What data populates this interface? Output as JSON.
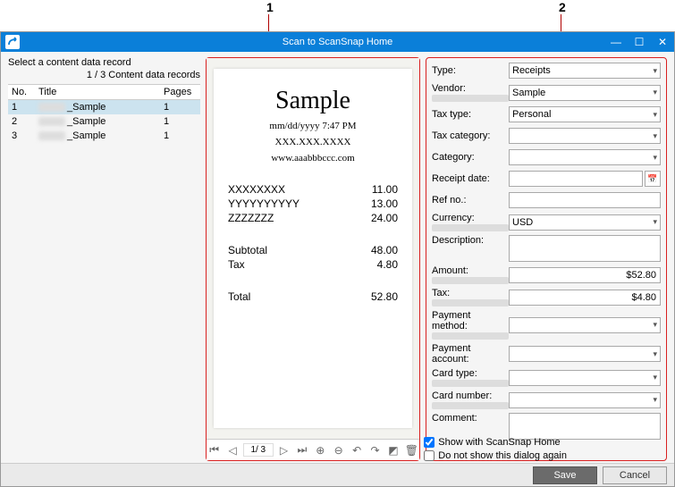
{
  "callouts": {
    "c1": "1",
    "c2": "2"
  },
  "titlebar": {
    "title": "Scan to ScanSnap Home"
  },
  "left": {
    "header": "Select a content data record",
    "count": "1 / 3 Content data records",
    "columns": {
      "no": "No.",
      "title": "Title",
      "pages": "Pages"
    },
    "rows": [
      {
        "no": "1",
        "title": "_Sample",
        "pages": "1"
      },
      {
        "no": "2",
        "title": "_Sample",
        "pages": "1"
      },
      {
        "no": "3",
        "title": "_Sample",
        "pages": "1"
      }
    ]
  },
  "receipt": {
    "title": "Sample",
    "datetime": "mm/dd/yyyy 7:47 PM",
    "phone": "XXX.XXX.XXXX",
    "website": "www.aaabbbccc.com",
    "items": [
      {
        "name": "XXXXXXXX",
        "amount": "11.00"
      },
      {
        "name": "YYYYYYYYYY",
        "amount": "13.00"
      },
      {
        "name": "ZZZZZZZ",
        "amount": "24.00"
      }
    ],
    "subtotal_label": "Subtotal",
    "subtotal": "48.00",
    "tax_label": "Tax",
    "tax": "4.80",
    "total_label": "Total",
    "total": "52.80"
  },
  "preview_nav": {
    "page": "1/   3"
  },
  "form": {
    "type_label": "Type:",
    "type_value": "Receipts",
    "vendor_label": "Vendor:",
    "vendor_value": "Sample",
    "taxtype_label": "Tax type:",
    "taxtype_value": "Personal",
    "taxcat_label": "Tax category:",
    "taxcat_value": "",
    "category_label": "Category:",
    "category_value": "",
    "receiptdate_label": "Receipt date:",
    "receiptdate_value": "",
    "refno_label": "Ref no.:",
    "refno_value": "",
    "currency_label": "Currency:",
    "currency_value": "USD",
    "description_label": "Description:",
    "description_value": "",
    "amount_label": "Amount:",
    "amount_value": "$52.80",
    "tax_label": "Tax:",
    "tax_value": "$4.80",
    "paymethod_label": "Payment method:",
    "paymethod_value": "",
    "payaccount_label": "Payment account:",
    "payaccount_value": "",
    "cardtype_label": "Card type:",
    "cardtype_value": "",
    "cardnumber_label": "Card number:",
    "cardnumber_value": "",
    "comment_label": "Comment:",
    "comment_value": ""
  },
  "checks": {
    "show": "Show with ScanSnap Home",
    "dont": "Do not show this dialog again"
  },
  "footer": {
    "save": "Save",
    "cancel": "Cancel"
  }
}
